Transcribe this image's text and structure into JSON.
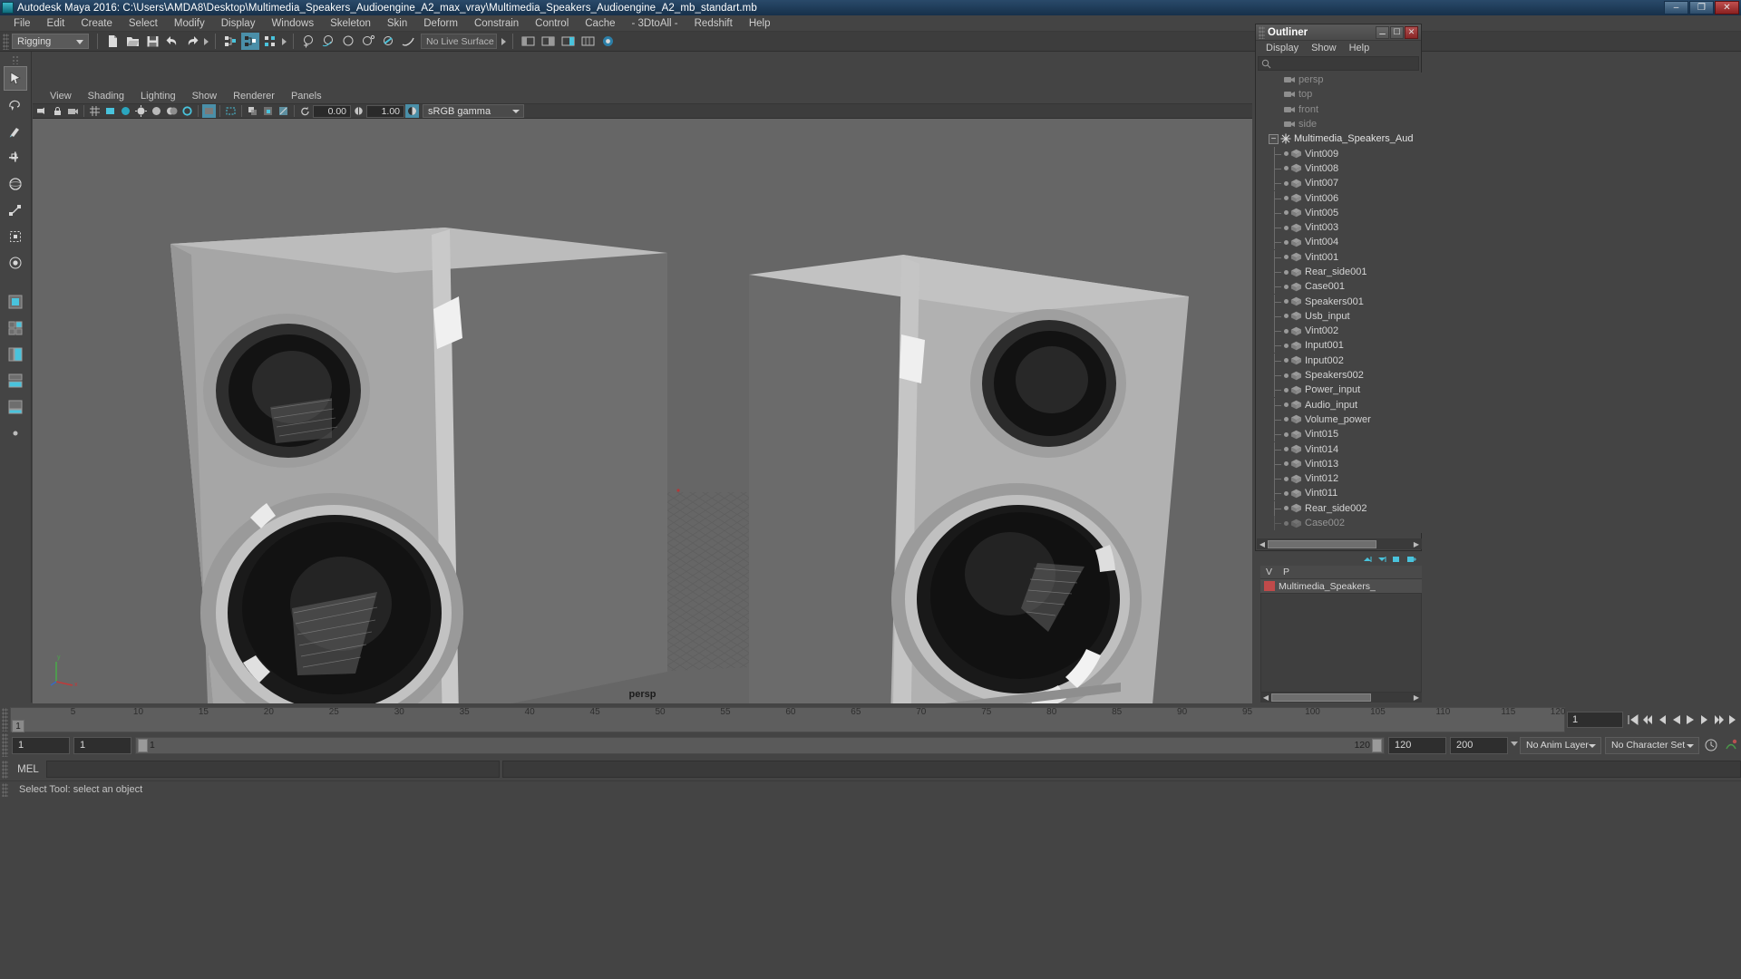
{
  "window": {
    "title": "Autodesk Maya 2016: C:\\Users\\AMDA8\\Desktop\\Multimedia_Speakers_Audioengine_A2_max_vray\\Multimedia_Speakers_Audioengine_A2_mb_standart.mb",
    "minimize_label": "–",
    "maximize_label": "❐",
    "close_label": "✕",
    "app_icon": "maya-icon"
  },
  "menubar": {
    "items": [
      "File",
      "Edit",
      "Create",
      "Select",
      "Modify",
      "Display",
      "Windows",
      "Skeleton",
      "Skin",
      "Deform",
      "Constrain",
      "Control",
      "Cache",
      "- 3DtoAll -",
      "Redshift",
      "Help"
    ]
  },
  "statusline": {
    "menu_set": "Rigging",
    "live_surface": "No Live Surface",
    "icons": [
      "new-scene-icon",
      "open-scene-icon",
      "save-scene-icon",
      "undo-icon",
      "redo-icon",
      "select-by-hierarchy-icon",
      "select-by-object-icon",
      "select-by-component-icon",
      "snap-to-grid-icon",
      "snap-to-curve-icon",
      "snap-to-point-icon",
      "snap-to-projected-center-icon",
      "snap-to-view-plane-icon",
      "make-live-icon",
      "show-hide-editors-icon",
      "attribute-editor-icon",
      "tool-settings-icon",
      "channel-box-icon",
      "render-icon"
    ]
  },
  "toolbox": {
    "tools": [
      {
        "name": "select-tool",
        "selected": true
      },
      {
        "name": "lasso-select-tool",
        "selected": false
      },
      {
        "name": "paint-select-tool",
        "selected": false
      },
      {
        "name": "move-tool",
        "selected": false
      },
      {
        "name": "rotate-tool",
        "selected": false
      },
      {
        "name": "scale-tool",
        "selected": false
      },
      {
        "name": "universal-manipulator",
        "selected": false
      },
      {
        "name": "soft-select-tool",
        "selected": false
      },
      {
        "name": "last-tool",
        "selected": false
      }
    ],
    "layouts": [
      {
        "name": "single-perspective-layout"
      },
      {
        "name": "four-view-layout"
      },
      {
        "name": "persp-outliner-layout"
      },
      {
        "name": "hypergraph-layout"
      },
      {
        "name": "persp-graph-layout"
      },
      {
        "name": "two-pane-layout"
      }
    ]
  },
  "viewport_panel": {
    "menus": [
      "View",
      "Shading",
      "Lighting",
      "Show",
      "Renderer",
      "Panels"
    ],
    "camera_label": "persp",
    "exposure": "0.00",
    "gamma": "1.00",
    "color_management": "sRGB gamma",
    "toolbar_icons": [
      "select-camera-icon",
      "lock-camera-icon",
      "camera-attributes-icon",
      "bookmark-icon",
      "image-plane-icon",
      "two-sided-lighting-icon",
      "shadows-icon",
      "ao-icon",
      "motion-blur-icon",
      "wireframe-icon",
      "smooth-shade-icon",
      "smooth-shade-all-icon",
      "textured-icon",
      "use-lights-icon",
      "xray-icon",
      "xray-joints-icon",
      "isolate-select-icon",
      "grid-toggle-icon",
      "film-gate-icon",
      "resolution-gate-icon",
      "gate-mask-icon",
      "exposure-icon",
      "gamma-icon"
    ]
  },
  "outliner": {
    "title": "Outliner",
    "window_buttons": [
      "minimize",
      "maximize",
      "close"
    ],
    "menus": [
      "Display",
      "Show",
      "Help"
    ],
    "search_placeholder": "",
    "items": [
      {
        "label": "persp",
        "icon": "camera-icon",
        "depth": 1,
        "dim": true
      },
      {
        "label": "top",
        "icon": "camera-icon",
        "depth": 1,
        "dim": true
      },
      {
        "label": "front",
        "icon": "camera-icon",
        "depth": 1,
        "dim": true
      },
      {
        "label": "side",
        "icon": "camera-icon",
        "depth": 1,
        "dim": true
      },
      {
        "label": "Multimedia_Speakers_Aud",
        "icon": "group-icon",
        "depth": 0,
        "expanded": true
      },
      {
        "label": "Vint009",
        "icon": "mesh-icon",
        "depth": 2
      },
      {
        "label": "Vint008",
        "icon": "mesh-icon",
        "depth": 2
      },
      {
        "label": "Vint007",
        "icon": "mesh-icon",
        "depth": 2
      },
      {
        "label": "Vint006",
        "icon": "mesh-icon",
        "depth": 2
      },
      {
        "label": "Vint005",
        "icon": "mesh-icon",
        "depth": 2
      },
      {
        "label": "Vint003",
        "icon": "mesh-icon",
        "depth": 2
      },
      {
        "label": "Vint004",
        "icon": "mesh-icon",
        "depth": 2
      },
      {
        "label": "Vint001",
        "icon": "mesh-icon",
        "depth": 2
      },
      {
        "label": "Rear_side001",
        "icon": "mesh-icon",
        "depth": 2
      },
      {
        "label": "Case001",
        "icon": "mesh-icon",
        "depth": 2
      },
      {
        "label": "Speakers001",
        "icon": "mesh-icon",
        "depth": 2
      },
      {
        "label": "Usb_input",
        "icon": "mesh-icon",
        "depth": 2
      },
      {
        "label": "Vint002",
        "icon": "mesh-icon",
        "depth": 2
      },
      {
        "label": "Input001",
        "icon": "mesh-icon",
        "depth": 2
      },
      {
        "label": "Input002",
        "icon": "mesh-icon",
        "depth": 2
      },
      {
        "label": "Speakers002",
        "icon": "mesh-icon",
        "depth": 2
      },
      {
        "label": "Power_input",
        "icon": "mesh-icon",
        "depth": 2
      },
      {
        "label": "Audio_input",
        "icon": "mesh-icon",
        "depth": 2
      },
      {
        "label": "Volume_power",
        "icon": "mesh-icon",
        "depth": 2
      },
      {
        "label": "Vint015",
        "icon": "mesh-icon",
        "depth": 2
      },
      {
        "label": "Vint014",
        "icon": "mesh-icon",
        "depth": 2
      },
      {
        "label": "Vint013",
        "icon": "mesh-icon",
        "depth": 2
      },
      {
        "label": "Vint012",
        "icon": "mesh-icon",
        "depth": 2
      },
      {
        "label": "Vint011",
        "icon": "mesh-icon",
        "depth": 2
      },
      {
        "label": "Rear_side002",
        "icon": "mesh-icon",
        "depth": 2
      },
      {
        "label": "Case002",
        "icon": "mesh-icon",
        "depth": 2
      }
    ]
  },
  "layer_editor": {
    "columns": [
      "V",
      "P"
    ],
    "layers": [
      {
        "name": "Multimedia_Speakers_",
        "color": "#c04a4a",
        "visible": "V",
        "playback": "P"
      }
    ],
    "toolbar_icons": [
      "new-layer-icon",
      "new-layer-from-selected-icon",
      "move-layer-up-icon",
      "move-layer-down-icon"
    ]
  },
  "time_slider": {
    "current_frame": "1",
    "tick_labels": [
      "5",
      "10",
      "15",
      "20",
      "25",
      "30",
      "35",
      "40",
      "45",
      "50",
      "55",
      "60",
      "65",
      "70",
      "75",
      "80",
      "85",
      "90",
      "95",
      "100",
      "105",
      "110",
      "115",
      "120"
    ],
    "start": 1,
    "end": 120,
    "end_field": "1",
    "playback_buttons": [
      "go-to-start-icon",
      "step-back-keyframe-icon",
      "step-back-frame-icon",
      "play-backwards-icon",
      "play-forwards-icon",
      "step-forward-frame-icon",
      "step-forward-keyframe-icon",
      "go-to-end-icon"
    ]
  },
  "range_slider": {
    "range_start": "1",
    "range_end": "1",
    "playback_start": "1",
    "playback_end": "120",
    "anim_end": "120",
    "total_end": "200",
    "anim_layer": "No Anim Layer",
    "character_set": "No Character Set",
    "icons": [
      "auto-key-icon",
      "animation-preferences-icon"
    ]
  },
  "command_line": {
    "language_label": "MEL",
    "input_value": "",
    "output_value": ""
  },
  "help_line": {
    "text": "Select Tool: select an object"
  },
  "scene": {
    "viewport_label": "persp",
    "background_color": "#666666",
    "object_color": "#a8a8a8",
    "description": "Two Audioengine A2 multimedia speakers shown in perspective view, shaded grey, with a ground grid plane"
  }
}
